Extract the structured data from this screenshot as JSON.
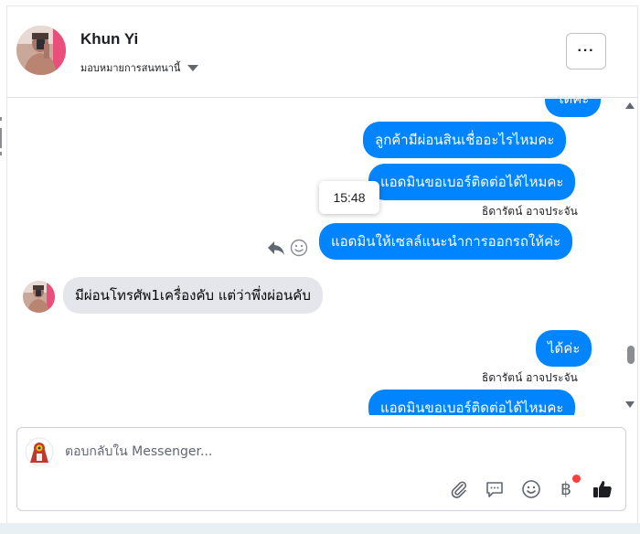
{
  "header": {
    "contact_name": "Khun Yi",
    "assign_label": "มอบหมายการสนทนานี้",
    "more_label": "···"
  },
  "thread": {
    "messages": [
      {
        "direction": "out",
        "text": "ได้ค่ะ"
      },
      {
        "direction": "out",
        "text": "ลูกค้ามีผ่อนสินเชื่ออะไรไหมคะ"
      },
      {
        "direction": "out",
        "text": "แอดมินขอเบอร์ติดต่อได้ไหมคะ"
      },
      {
        "direction": "out",
        "text": "แอดมินให้เซลล์แนะนำการออกรถให้ค่ะ"
      },
      {
        "direction": "in",
        "text": "มีผ่อนโทรศัพ1เครื่องคับ แต่ว่าพึ่งผ่อนคับ"
      },
      {
        "direction": "out",
        "text": "ได้ค่ะ"
      },
      {
        "direction": "out",
        "text": "แอดมินขอเบอร์ติดต่อได้ไหมคะ"
      }
    ],
    "sender_labels": [
      "ธิดารัตน์ อาจประจัน",
      "ธิดารัตน์ อาจประจัน"
    ],
    "tooltip_time": "15:48"
  },
  "composer": {
    "placeholder": "ตอบกลับใน Messenger...",
    "value": "",
    "baht_symbol": "฿"
  },
  "icons": {
    "reply": "reply-icon",
    "react": "smile-icon",
    "attach": "paperclip-icon",
    "saved_replies": "chat-bubble-icon",
    "emoji": "emoji-icon",
    "payment": "baht-icon",
    "like": "thumbs-up-icon"
  },
  "colors": {
    "outgoing_bubble": "#0084ff",
    "incoming_bubble": "#e4e6eb",
    "like_icon": "#1c1e21",
    "notification_dot": "#fa3e3e"
  }
}
